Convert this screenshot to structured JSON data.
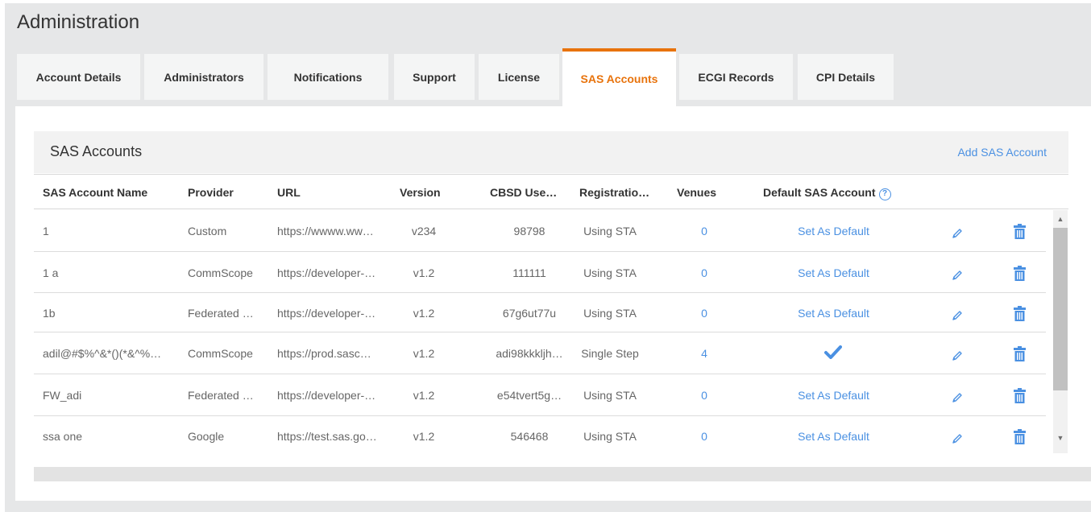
{
  "page_title": "Administration",
  "tabs": [
    {
      "label": "Account Details"
    },
    {
      "label": "Administrators"
    },
    {
      "label": "Notifications"
    },
    {
      "label": "Support"
    },
    {
      "label": "License"
    },
    {
      "label": "SAS Accounts",
      "active": true
    },
    {
      "label": "ECGI Records"
    },
    {
      "label": "CPI Details"
    }
  ],
  "card": {
    "title": "SAS Accounts",
    "add_link": "Add SAS Account"
  },
  "table": {
    "columns": [
      "SAS Account Name",
      "Provider",
      "URL",
      "Version",
      "CBSD Use…",
      "Registratio…",
      "Venues",
      "Default SAS Account"
    ],
    "rows": [
      {
        "name": "1",
        "provider": "Custom",
        "url": "https://wwww.ww…",
        "version": "v234",
        "cbsd": "98798",
        "registration": "Using STA",
        "venues": "0",
        "default": "Set As Default"
      },
      {
        "name": "1 a",
        "provider": "CommScope",
        "url": "https://developer-…",
        "version": "v1.2",
        "cbsd": "111111",
        "registration": "Using STA",
        "venues": "0",
        "default": "Set As Default"
      },
      {
        "name": "1b",
        "provider": "Federated …",
        "url": "https://developer-…",
        "version": "v1.2",
        "cbsd": "67g6ut77u",
        "registration": "Using STA",
        "venues": "0",
        "default": "Set As Default"
      },
      {
        "name": "adil@#$%^&*()(*&^%…",
        "provider": "CommScope",
        "url": "https://prod.sasc…",
        "version": "v1.2",
        "cbsd": "adi98kkkljh…",
        "registration": "Single Step",
        "venues": "4",
        "default": "",
        "is_default": true
      },
      {
        "name": "FW_adi",
        "provider": "Federated …",
        "url": "https://developer-…",
        "version": "v1.2",
        "cbsd": "e54tvert5g…",
        "registration": "Using STA",
        "venues": "0",
        "default": "Set As Default"
      },
      {
        "name": "ssa one",
        "provider": "Google",
        "url": "https://test.sas.go…",
        "version": "v1.2",
        "cbsd": "546468",
        "registration": "Using STA",
        "venues": "0",
        "default": "Set As Default"
      }
    ]
  },
  "icons": {
    "edit": "pencil-icon",
    "delete": "trash-icon",
    "help": "question-circle-icon",
    "default_marker": "checkmark-icon"
  },
  "colors": {
    "accent_orange": "#e8730c",
    "link_blue": "#4a90e2"
  }
}
